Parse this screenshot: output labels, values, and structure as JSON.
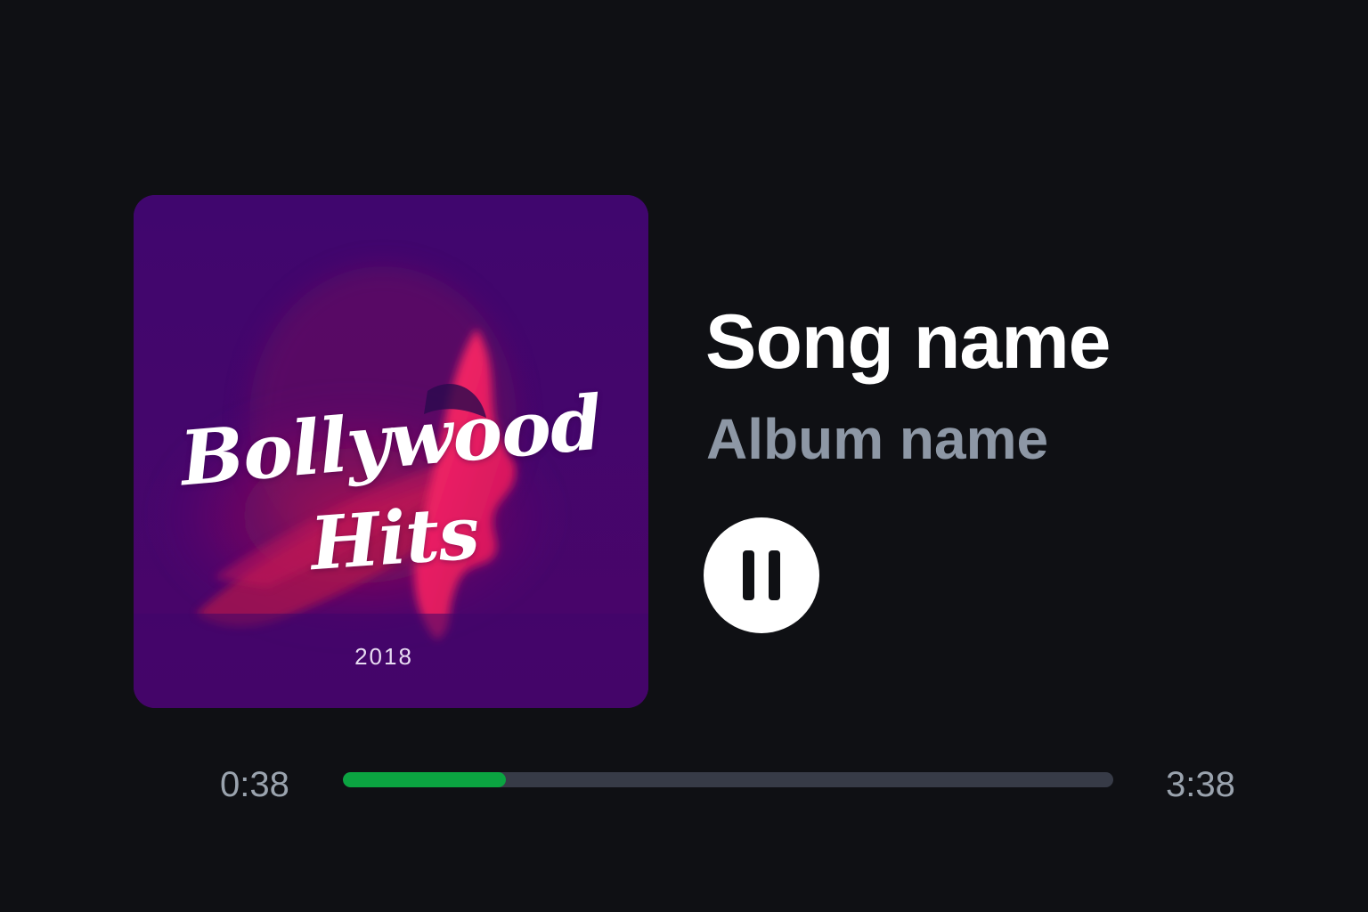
{
  "track": {
    "song_title": "Song name",
    "album_name": "Album name"
  },
  "artwork": {
    "title_line1": "Bollywood",
    "title_line2": "Hits",
    "year": "2018"
  },
  "controls": {
    "play_state": "playing",
    "primary_icon": "pause-icon"
  },
  "progress": {
    "elapsed": "0:38",
    "total": "3:38",
    "fraction": 0.2111
  },
  "colors": {
    "background": "#0f1014",
    "accent": "#0ba441",
    "track": "#373b47",
    "album_text": "#8d97a5",
    "artwork_base": "#44066b",
    "artwork_highlight": "#e2165e"
  }
}
